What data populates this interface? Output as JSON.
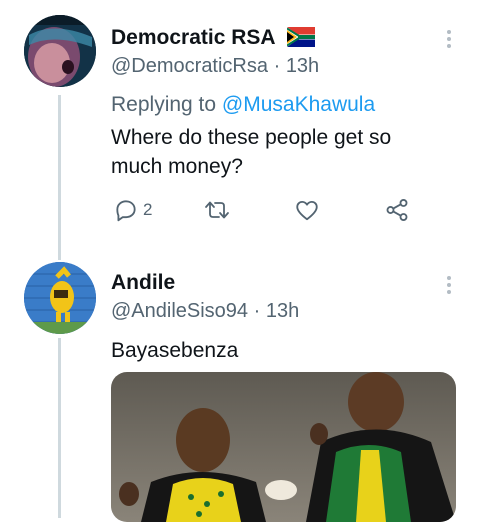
{
  "tweets": [
    {
      "display_name": "Democratic RSA",
      "handle": "@DemocraticRsa",
      "separator": "·",
      "time": "13h",
      "reply_prefix": "Replying to",
      "reply_to": "@MusaKhawula",
      "text_line1": "Where do these people get so",
      "text_line2": "much money?",
      "reply_count": "2",
      "icons": {
        "flag": "south-africa-flag-icon",
        "more": "more-vertical-icon",
        "reply": "reply-icon",
        "retweet": "retweet-icon",
        "like": "heart-icon",
        "share": "share-icon"
      }
    },
    {
      "display_name": "Andile",
      "handle": "@AndileSiso94",
      "separator": "·",
      "time": "13h",
      "text": "Bayasebenza",
      "media": "photo",
      "icons": {
        "more": "more-vertical-icon"
      }
    }
  ],
  "colors": {
    "link": "#1d9bf0",
    "secondary": "#536471",
    "thread_line": "#cfd9de"
  }
}
